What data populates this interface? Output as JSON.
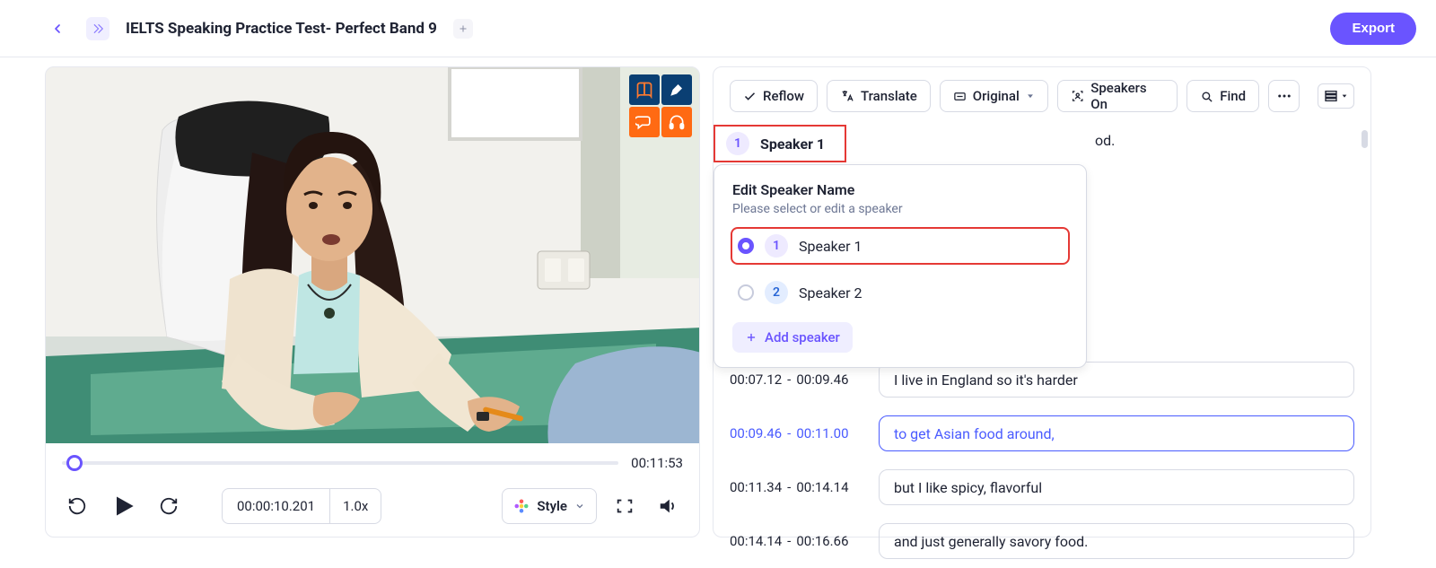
{
  "header": {
    "title": "IELTS Speaking Practice Test- Perfect Band 9",
    "export_label": "Export"
  },
  "video": {
    "duration": "00:11:53",
    "timecode": "00:00:10.201",
    "rate": "1.0x",
    "style_label": "Style"
  },
  "toolbar": {
    "reflow": "Reflow",
    "translate": "Translate",
    "original": "Original",
    "speakers_on": "Speakers On",
    "find": "Find"
  },
  "speakerHeader": {
    "num": "1",
    "label": "Speaker 1"
  },
  "peek": {
    "text1": "od.",
    "text2": ""
  },
  "dropdown": {
    "title": "Edit Speaker Name",
    "subtitle": "Please select or edit a speaker",
    "options": [
      {
        "num": "1",
        "label": "Speaker 1"
      },
      {
        "num": "2",
        "label": "Speaker 2"
      }
    ],
    "add_label": "Add speaker"
  },
  "lines": [
    {
      "start": "00:07.12",
      "end": "00:09.46",
      "text": "I live in England so it's harder",
      "active": false
    },
    {
      "start": "00:09.46",
      "end": "00:11.00",
      "text": "to get Asian food around,",
      "active": true
    },
    {
      "start": "00:11.34",
      "end": "00:14.14",
      "text": "but I like spicy, flavorful",
      "active": false
    },
    {
      "start": "00:14.14",
      "end": "00:16.66",
      "text": "and just generally savory food.",
      "active": false
    }
  ]
}
